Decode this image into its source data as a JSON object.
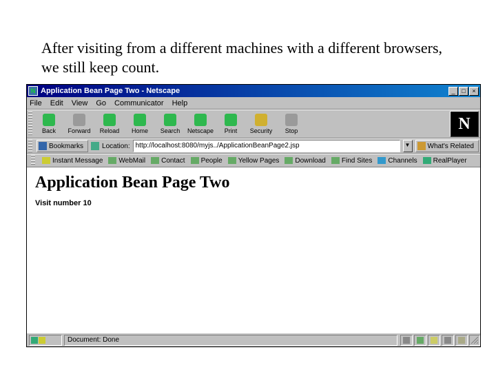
{
  "slide": {
    "caption": "After visiting from a different machines with a different browsers, we still keep count."
  },
  "titlebar": {
    "title": "Application Bean Page Two - Netscape",
    "min": "_",
    "max": "□",
    "close": "×"
  },
  "menu": {
    "items": [
      "File",
      "Edit",
      "View",
      "Go",
      "Communicator",
      "Help"
    ]
  },
  "toolbar": {
    "buttons": [
      {
        "label": "Back",
        "color": "#2eb84e"
      },
      {
        "label": "Forward",
        "color": "#9a9a9a"
      },
      {
        "label": "Reload",
        "color": "#2eb84e"
      },
      {
        "label": "Home",
        "color": "#2eb84e"
      },
      {
        "label": "Search",
        "color": "#2eb84e"
      },
      {
        "label": "Netscape",
        "color": "#2eb84e"
      },
      {
        "label": "Print",
        "color": "#2eb84e"
      },
      {
        "label": "Security",
        "color": "#d0b030"
      },
      {
        "label": "Stop",
        "color": "#9a9a9a"
      }
    ],
    "logo": "N"
  },
  "location": {
    "bookmarks_label": "Bookmarks",
    "location_label": "Location:",
    "url": "http://localhost:8080/myjs../ApplicationBeanPage2.jsp",
    "whats_related": "What's Related"
  },
  "linksbar": {
    "items": [
      "Instant Message",
      "WebMail",
      "Contact",
      "People",
      "Yellow Pages",
      "Download",
      "Find Sites",
      "Channels",
      "RealPlayer"
    ]
  },
  "page": {
    "title": "Application Bean Page Two",
    "body": "Visit number 10"
  },
  "status": {
    "message": "Document: Done"
  }
}
